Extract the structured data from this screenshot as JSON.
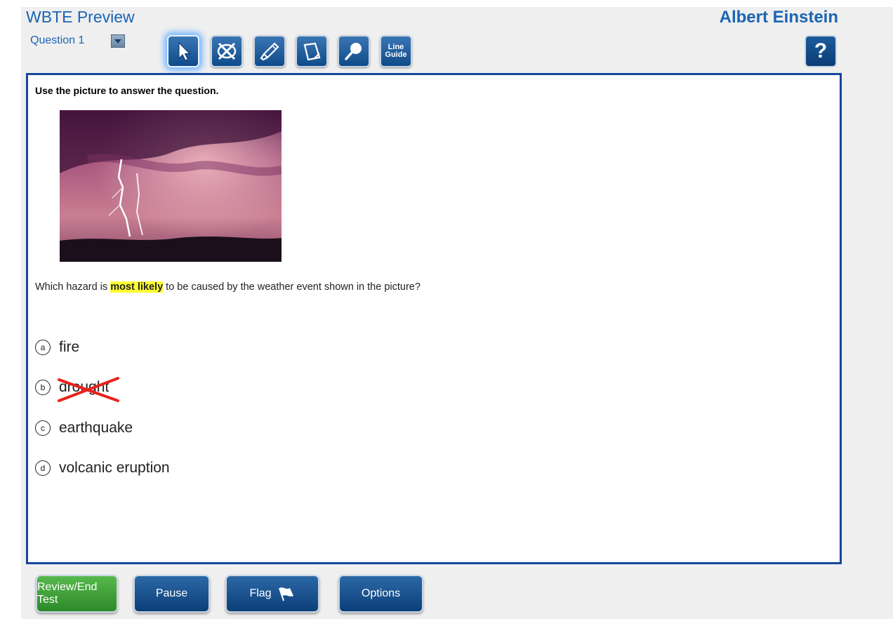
{
  "header": {
    "app_title": "WBTE Preview",
    "user_name": "Albert Einstein",
    "question_label": "Question 1",
    "help_label": "?"
  },
  "toolbar": {
    "tools": [
      {
        "name": "pointer",
        "icon": "arrow-pointer-icon",
        "active": true
      },
      {
        "name": "answer-eliminator",
        "icon": "eliminator-x-icon",
        "active": false
      },
      {
        "name": "highlighter",
        "icon": "highlighter-icon",
        "active": false
      },
      {
        "name": "sticky-note",
        "icon": "note-icon",
        "active": false
      },
      {
        "name": "magnifier",
        "icon": "magnifier-icon",
        "active": false
      },
      {
        "name": "line-guide",
        "icon": "line-guide-icon",
        "label_line1": "Line",
        "label_line2": "Guide",
        "active": false
      }
    ]
  },
  "question": {
    "instructions": "Use the picture to answer the question.",
    "image_icon": "lightning-storm-photo",
    "text_before": "Which hazard is ",
    "text_highlight": "most likely",
    "text_after": " to be caused by the weather event shown in the picture?",
    "answers": [
      {
        "letter": "a",
        "text": "fire",
        "eliminated": false
      },
      {
        "letter": "b",
        "text": "drought",
        "eliminated": true
      },
      {
        "letter": "c",
        "text": "earthquake",
        "eliminated": false
      },
      {
        "letter": "d",
        "text": "volcanic eruption",
        "eliminated": false
      }
    ]
  },
  "footer": {
    "review_label": "Review/End Test",
    "pause_label": "Pause",
    "flag_label": "Flag",
    "options_label": "Options"
  },
  "colors": {
    "accent_blue": "#1a64b4",
    "border_blue": "#16479a",
    "button_blue": "#0c3f78",
    "button_green": "#2d8a2a",
    "highlight_yellow": "#ffff33",
    "elimination_red": "#e8221b"
  }
}
